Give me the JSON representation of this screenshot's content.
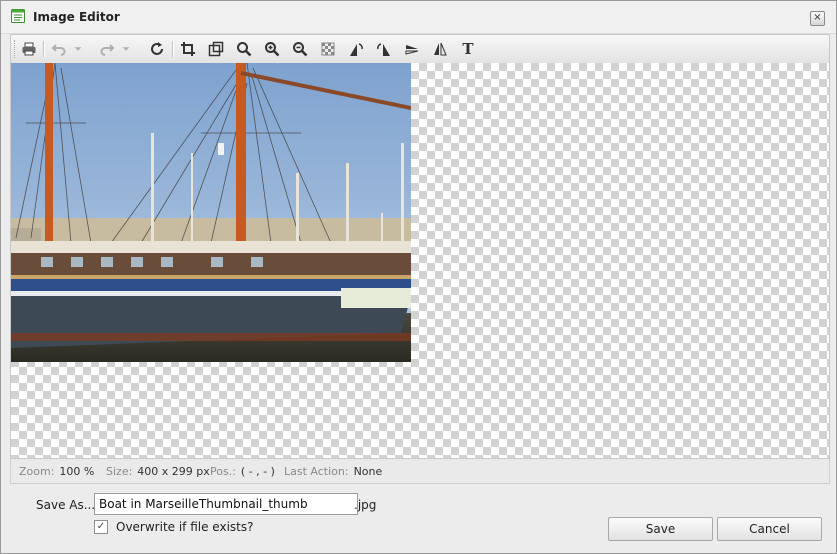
{
  "window": {
    "title": "Image Editor",
    "close_glyph": "×"
  },
  "toolbar": {
    "items": [
      {
        "name": "print-icon"
      },
      {
        "name": "undo-icon"
      },
      {
        "name": "undo-dropdown-icon"
      },
      {
        "name": "redo-icon"
      },
      {
        "name": "redo-dropdown-icon"
      },
      {
        "name": "refresh-icon"
      },
      {
        "name": "crop-icon"
      },
      {
        "name": "resize-icon"
      },
      {
        "name": "zoom-icon"
      },
      {
        "name": "zoom-in-icon"
      },
      {
        "name": "zoom-out-icon"
      },
      {
        "name": "transparency-icon"
      },
      {
        "name": "rotate-left-icon"
      },
      {
        "name": "rotate-right-icon"
      },
      {
        "name": "flip-vertical-icon"
      },
      {
        "name": "flip-horizontal-icon"
      },
      {
        "name": "text-tool-icon"
      }
    ],
    "text_tool_glyph": "T"
  },
  "canvas": {
    "image_alt": "Boat in Marseille"
  },
  "status": {
    "zoom_label": "Zoom:",
    "zoom_value": "100 %",
    "size_label": "Size:",
    "size_value": "400 x 299 px",
    "pos_label": "Pos.:",
    "pos_value": "( - , - )",
    "last_action_label": "Last Action:",
    "last_action_value": "None"
  },
  "form": {
    "save_as_label": "Save As...",
    "filename_value": "Boat in MarseilleThumbnail_thumb",
    "extension": ".jpg",
    "overwrite_label": "Overwrite if file exists?",
    "overwrite_checked": true,
    "check_glyph": "✓",
    "save_button": "Save",
    "cancel_button": "Cancel"
  }
}
